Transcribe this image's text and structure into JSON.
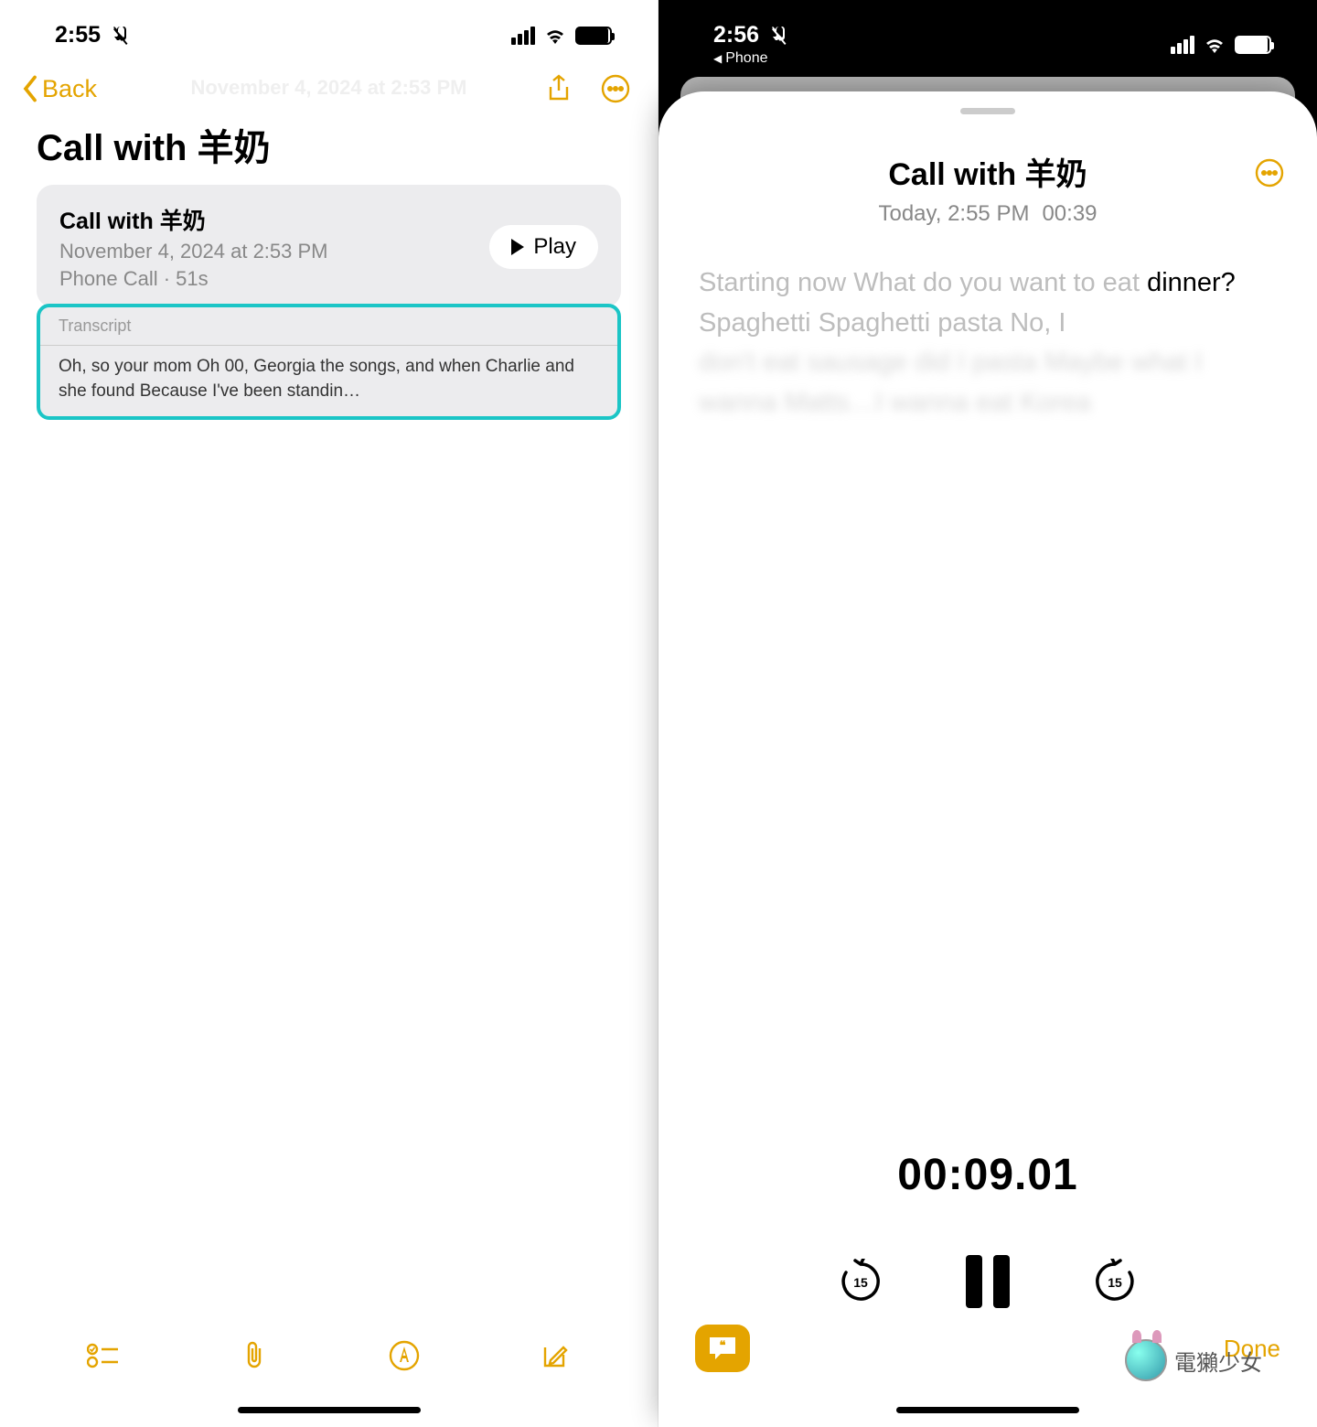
{
  "left": {
    "status": {
      "time": "2:55"
    },
    "nav": {
      "back_label": "Back"
    },
    "faded_date": "November 4, 2024 at 2:53 PM",
    "title": "Call with 羊奶",
    "card": {
      "title": "Call with 羊奶",
      "date": "November 4, 2024 at 2:53 PM",
      "meta": "Phone Call · 51s",
      "play_label": "Play"
    },
    "transcript": {
      "header": "Transcript",
      "body": "Oh, so your mom Oh 00, Georgia the songs, and when Charlie and she found  Because I've been standin…"
    }
  },
  "right": {
    "status": {
      "time": "2:56",
      "back_app": "Phone"
    },
    "sheet": {
      "title": "Call with 羊奶",
      "sub_date": "Today, 2:55 PM",
      "sub_duration": "00:39",
      "transcript_before": "Starting now What do you want to eat ",
      "transcript_active": "dinner?",
      "transcript_after_1": " Spaghetti Spaghetti pasta No, I",
      "transcript_after_2": "don't eat sausage did I pasta Maybe what I wanna Matts…I wanna eat Korea",
      "playback_time": "00:09.01",
      "done_label": "Done"
    },
    "watermark": "電獺少女"
  }
}
